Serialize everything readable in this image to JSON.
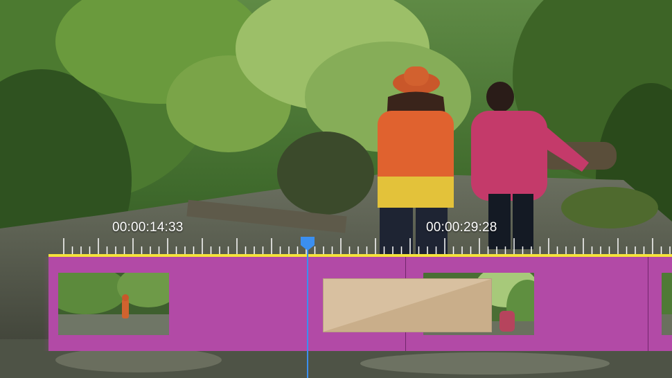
{
  "timeline": {
    "timecode_left": "00:00:14:33",
    "timecode_right": "00:00:29:28"
  },
  "colors": {
    "track_clip": "#b24aa6",
    "ruler": "#f5e23a",
    "playhead": "#3b8ff0",
    "transition": "#d8c0a0"
  },
  "icons": {
    "playhead": "playhead-marker-icon",
    "transition": "cross-dissolve-transition-icon"
  }
}
